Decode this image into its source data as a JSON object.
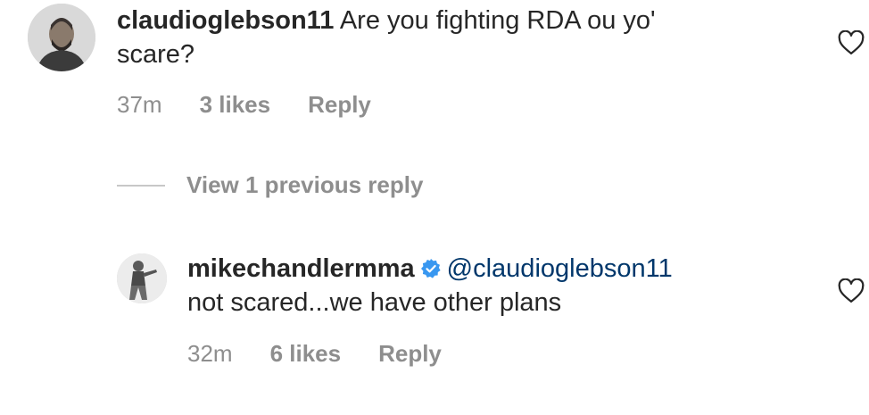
{
  "comments": [
    {
      "username": "claudioglebson11",
      "text_line1": "Are you fighting RDA ou yo'",
      "text_line2": "scare?",
      "time": "37m",
      "likes": "3 likes",
      "reply": "Reply"
    }
  ],
  "view_replies": "View 1 previous reply",
  "reply_comment": {
    "username": "mikechandlermma",
    "verified": true,
    "mention": "@claudioglebson11",
    "text": "not scared...we have other plans",
    "time": "32m",
    "likes": "6 likes",
    "reply": "Reply"
  },
  "icons": {
    "like": "heart-outline-icon",
    "verified": "verified-badge-icon"
  },
  "colors": {
    "text": "#262626",
    "meta": "#8e8e8e",
    "mention": "#00376b",
    "verified": "#3897f0"
  }
}
